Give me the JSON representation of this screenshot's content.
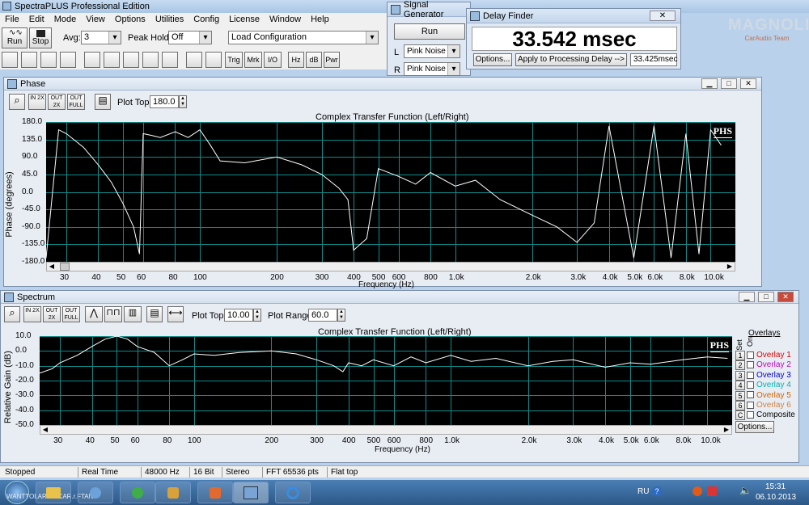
{
  "app": {
    "title": "SpectraPLUS Professional Edition"
  },
  "menu": [
    "File",
    "Edit",
    "Mode",
    "View",
    "Options",
    "Utilities",
    "Config",
    "License",
    "Window",
    "Help"
  ],
  "toolbar": {
    "run_label": "Run",
    "stop_label": "Stop",
    "avg_label": "Avg:",
    "avg_value": "3",
    "peak_hold_label": "Peak Hold:",
    "peak_hold_value": "Off",
    "load_config_value": "Load Configuration",
    "buttons": [
      "Trig",
      "Mrk",
      "I/O",
      "Hz",
      "dB",
      "Pwr"
    ]
  },
  "signal_generator": {
    "title": "Signal Generator",
    "run_label": "Run",
    "l_label": "L",
    "l_value": "Pink Noise",
    "r_label": "R",
    "r_value": "Pink Noise"
  },
  "delay_finder": {
    "title": "Delay Finder",
    "value": "33.542 msec",
    "options_label": "Options...",
    "apply_label": "Apply to Processing Delay -->",
    "result": "33.425msec"
  },
  "watermark": {
    "text": "MAGNOLIA",
    "sub": "CarAudio Team"
  },
  "phase": {
    "title": "Phase",
    "plot_top_label": "Plot Top:",
    "plot_top_value": "180.0",
    "zoom_buttons": [
      "IN 2X",
      "OUT 2X",
      "OUT FULL"
    ],
    "plot_title": "Complex Transfer Function (Left/Right)",
    "ylabel": "Phase (degrees)",
    "xlabel": "Frequency (Hz)",
    "badge": "PHS",
    "yticks": [
      "180.0",
      "135.0",
      "90.0",
      "45.0",
      "0.0",
      "-45.0",
      "-90.0",
      "-135.0",
      "-180.0"
    ]
  },
  "spectrum": {
    "title": "Spectrum",
    "plot_top_label": "Plot Top:",
    "plot_top_value": "10.00",
    "plot_range_label": "Plot Range:",
    "plot_range_value": "60.0",
    "zoom_buttons": [
      "IN 2X",
      "OUT 2X",
      "OUT FULL"
    ],
    "plot_title": "Complex Transfer Function (Left/Right)",
    "ylabel": "Relative Gain (dB)",
    "xlabel": "Frequency (Hz)",
    "badge": "PHS",
    "yticks": [
      "10.0",
      "0.0",
      "-10.0",
      "-20.0",
      "-30.0",
      "-40.0",
      "-50.0"
    ],
    "overlays_title": "Overlays",
    "set_label": "Set",
    "on_label": "On",
    "overlays": [
      {
        "num": "1",
        "name": "Overlay 1",
        "color": "#e00000"
      },
      {
        "num": "2",
        "name": "Overlay 2",
        "color": "#c000c0"
      },
      {
        "num": "3",
        "name": "Overlay 3",
        "color": "#0000d0"
      },
      {
        "num": "4",
        "name": "Overlay 4",
        "color": "#00b0b0"
      },
      {
        "num": "5",
        "name": "Overlay 5",
        "color": "#d06000"
      },
      {
        "num": "6",
        "name": "Overlay 6",
        "color": "#d08040"
      }
    ],
    "composite_num": "C",
    "composite_label": "Composite",
    "options_label": "Options..."
  },
  "xticks": [
    "30",
    "40",
    "50",
    "60",
    "80",
    "100",
    "200",
    "300",
    "400",
    "500",
    "600",
    "800",
    "1.0k",
    "2.0k",
    "3.0k",
    "4.0k",
    "5.0k",
    "6.0k",
    "8.0k",
    "10.0k"
  ],
  "status": {
    "state": "Stopped",
    "mode": "Real Time",
    "rate": "48000 Hz",
    "bits": "16 Bit",
    "channels": "Stereo",
    "fft": "FFT 65536 pts",
    "window": "Flat top"
  },
  "taskbar": {
    "lang": "RU",
    "time": "15:31",
    "date": "06.10.2013",
    "tray_text": "WANTTOLARGE CAR.r.FTAN"
  },
  "chart_data": [
    {
      "type": "line",
      "title": "Complex Transfer Function (Left/Right)",
      "xlabel": "Frequency (Hz)",
      "ylabel": "Phase (degrees)",
      "xscale": "log",
      "xlim": [
        25,
        12500
      ],
      "ylim": [
        -180,
        180
      ],
      "x": [
        25,
        28,
        30,
        35,
        40,
        45,
        50,
        55,
        58,
        60,
        65,
        70,
        80,
        90,
        100,
        110,
        120,
        150,
        200,
        250,
        300,
        350,
        380,
        400,
        450,
        500,
        600,
        700,
        800,
        1000,
        1200,
        1500,
        2000,
        2500,
        3000,
        3500,
        4000,
        5000,
        6000,
        7000,
        8000,
        9000,
        10000,
        11000
      ],
      "y": [
        -170,
        160,
        150,
        115,
        70,
        25,
        -30,
        -90,
        -160,
        150,
        145,
        140,
        155,
        140,
        160,
        120,
        80,
        75,
        90,
        70,
        45,
        10,
        -20,
        -150,
        -120,
        60,
        40,
        20,
        50,
        15,
        30,
        -20,
        -60,
        -90,
        -130,
        -80,
        170,
        -170,
        170,
        -170,
        150,
        -160,
        160,
        120
      ]
    },
    {
      "type": "line",
      "title": "Complex Transfer Function (Left/Right)",
      "xlabel": "Frequency (Hz)",
      "ylabel": "Relative Gain (dB)",
      "xscale": "log",
      "xlim": [
        25,
        12500
      ],
      "ylim": [
        -50,
        10
      ],
      "x": [
        25,
        28,
        30,
        35,
        40,
        45,
        50,
        55,
        60,
        70,
        80,
        90,
        100,
        120,
        150,
        200,
        250,
        300,
        350,
        380,
        400,
        450,
        500,
        600,
        700,
        800,
        1000,
        1200,
        1500,
        2000,
        2500,
        3000,
        4000,
        5000,
        6000,
        8000,
        10000,
        12000
      ],
      "y": [
        -15,
        -12,
        -8,
        -3,
        3,
        8,
        10,
        8,
        3,
        -1,
        -10,
        -6,
        -2,
        -3,
        -1,
        0,
        -2,
        -6,
        -10,
        -14,
        -8,
        -10,
        -6,
        -10,
        -4,
        -8,
        -3,
        -7,
        -5,
        -10,
        -7,
        -6,
        -11,
        -8,
        -9,
        -6,
        -4,
        -5
      ]
    }
  ]
}
